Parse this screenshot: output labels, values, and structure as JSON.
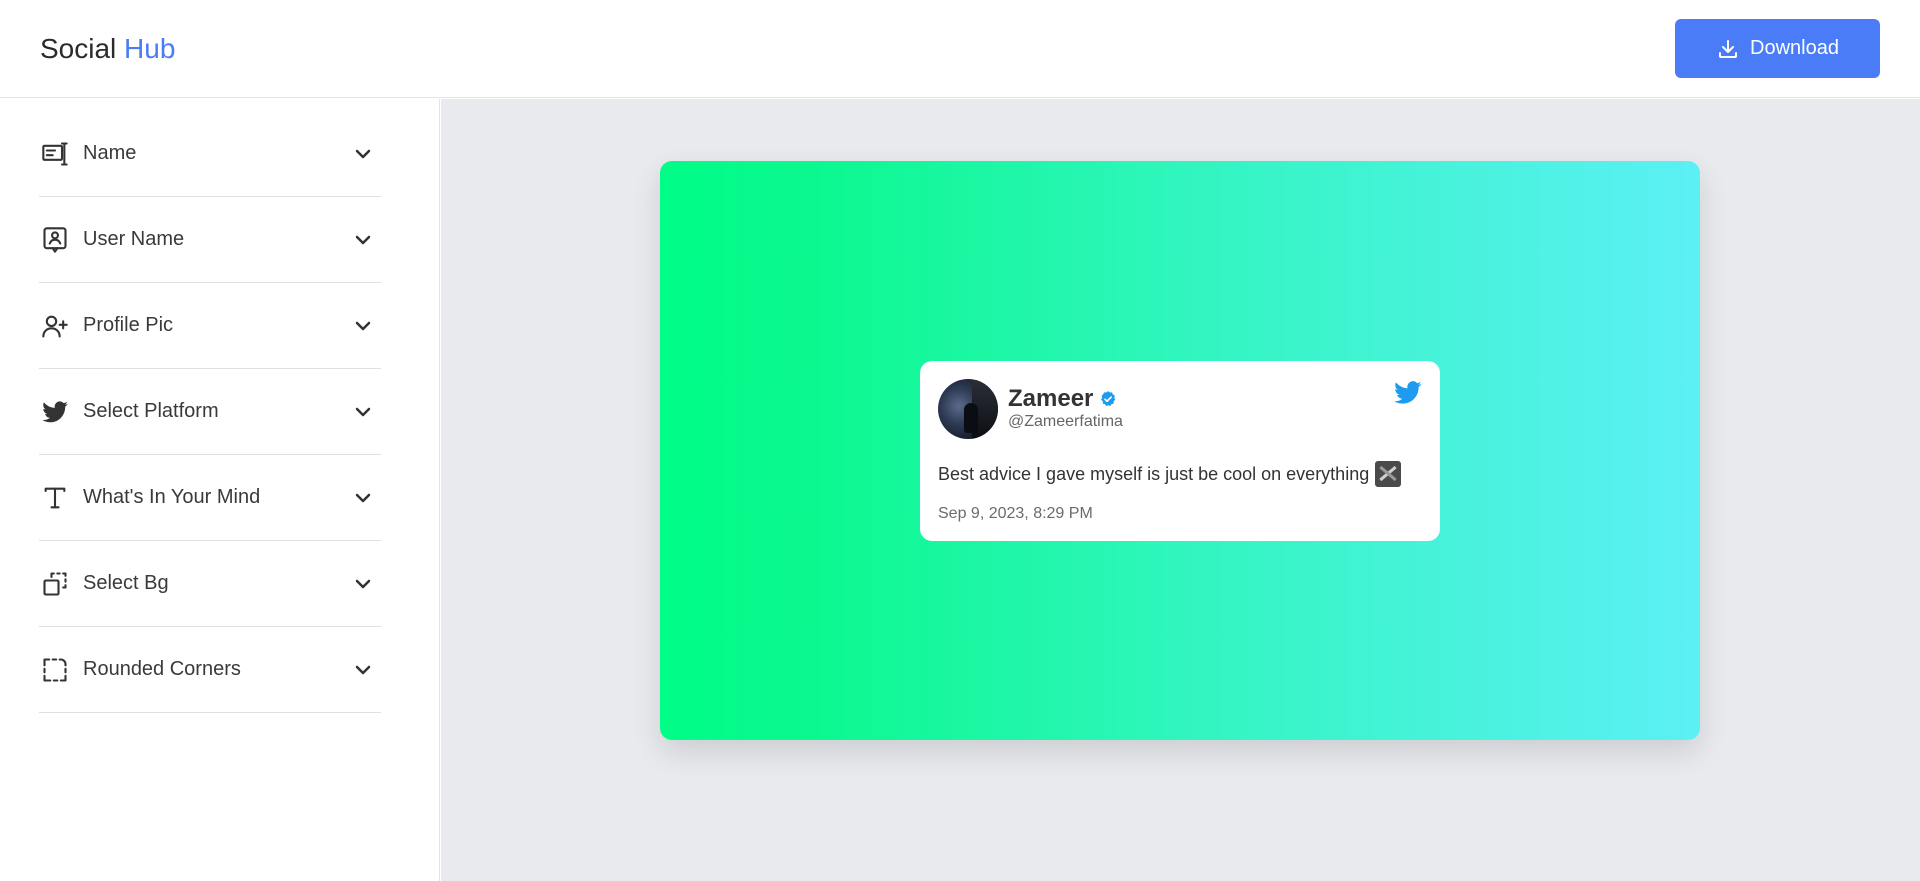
{
  "app": {
    "logo_word1": "Social",
    "logo_word2": "Hub",
    "accent_color": "#4a7cf7"
  },
  "toolbar": {
    "download_label": "Download",
    "download_icon": "download-icon"
  },
  "sidebar": {
    "items": [
      {
        "label": "Name",
        "icon": "name-card-icon"
      },
      {
        "label": "User Name",
        "icon": "user-badge-icon"
      },
      {
        "label": "Profile Pic",
        "icon": "user-plus-icon"
      },
      {
        "label": "Select Platform",
        "icon": "twitter-bird-icon"
      },
      {
        "label": "What's In Your Mind",
        "icon": "text-icon"
      },
      {
        "label": "Select Bg",
        "icon": "select-bg-icon"
      },
      {
        "label": "Rounded Corners",
        "icon": "rounded-corners-icon"
      }
    ]
  },
  "preview": {
    "gradient_colors": [
      "#00fd87",
      "#35f5c4",
      "#5cf0f5"
    ],
    "tweet": {
      "name": "Zameer",
      "handle": "@Zameerfatima",
      "text": "Best advice I gave myself is just be cool on everything",
      "date": "Sep 9, 2023, 8:29 PM",
      "verified": true,
      "platform_icon": "twitter-bird-icon",
      "platform_color": "#1d9bf0"
    }
  }
}
